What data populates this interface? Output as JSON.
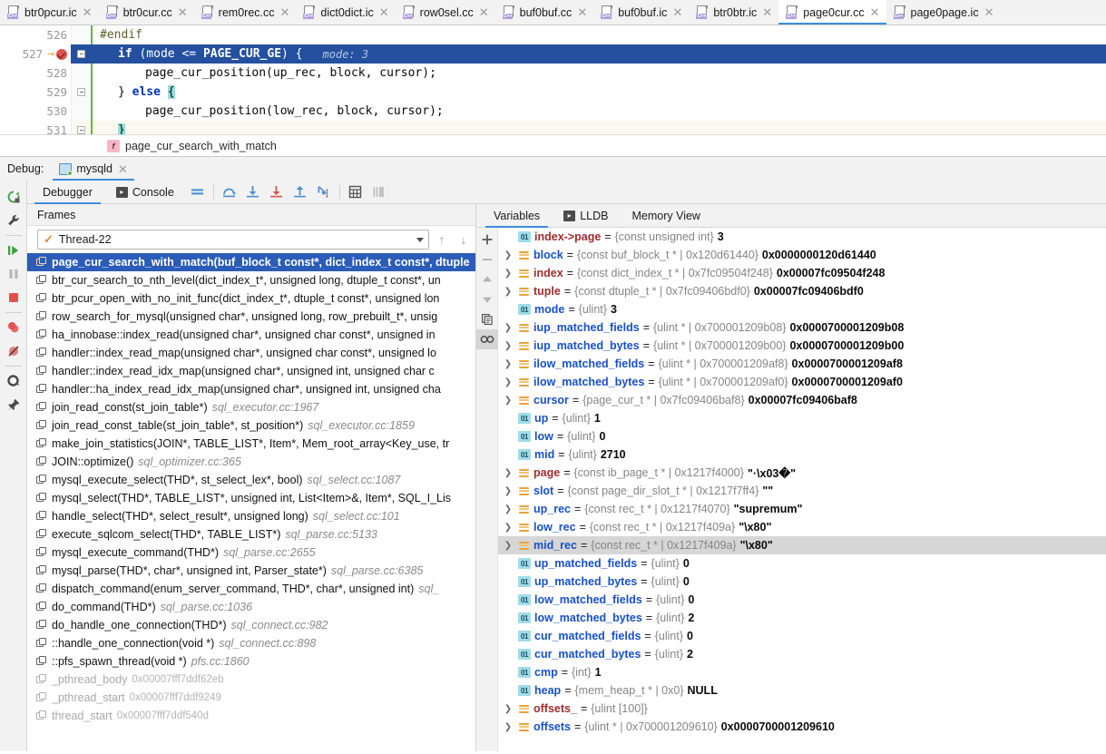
{
  "tabs": [
    {
      "label": "btr0pcur.ic",
      "active": false
    },
    {
      "label": "btr0cur.cc",
      "active": false
    },
    {
      "label": "rem0rec.cc",
      "active": false
    },
    {
      "label": "dict0dict.ic",
      "active": false
    },
    {
      "label": "row0sel.cc",
      "active": false
    },
    {
      "label": "buf0buf.cc",
      "active": false
    },
    {
      "label": "buf0buf.ic",
      "active": false
    },
    {
      "label": "btr0btr.ic",
      "active": false
    },
    {
      "label": "page0cur.cc",
      "active": true
    },
    {
      "label": "page0page.ic",
      "active": false
    }
  ],
  "tab_icon_label": "C++",
  "editor": {
    "lines": [
      {
        "number": "526",
        "highlighted": false,
        "text": "#endif"
      },
      {
        "number": "527",
        "highlighted": true,
        "text": "if (mode <= PAGE_CUR_GE) {",
        "hint": "mode: 3"
      },
      {
        "number": "528",
        "highlighted": false,
        "text": "page_cur_position(up_rec, block, cursor);"
      },
      {
        "number": "529",
        "highlighted": false,
        "text": "} else {"
      },
      {
        "number": "530",
        "highlighted": false,
        "text": "page_cur_position(low_rec, block, cursor);"
      },
      {
        "number": "531",
        "highlighted": false,
        "text": "}"
      }
    ]
  },
  "breadcrumb": {
    "function": "page_cur_search_with_match",
    "badge": "f"
  },
  "debug_header": {
    "label": "Debug:",
    "session": "mysqld"
  },
  "debug_tabs": {
    "debugger": "Debugger",
    "console": "Console"
  },
  "frames_panel": {
    "header": "Frames",
    "thread": "Thread-22",
    "items": [
      {
        "sig": "page_cur_search_with_match(buf_block_t const*, dict_index_t const*, dtuple",
        "loc": "",
        "selected": true,
        "dim": false
      },
      {
        "sig": "btr_cur_search_to_nth_level(dict_index_t*, unsigned long, dtuple_t const*, un",
        "loc": "",
        "selected": false,
        "dim": false
      },
      {
        "sig": "btr_pcur_open_with_no_init_func(dict_index_t*, dtuple_t const*, unsigned lon",
        "loc": "",
        "selected": false,
        "dim": false
      },
      {
        "sig": "row_search_for_mysql(unsigned char*, unsigned long, row_prebuilt_t*, unsig",
        "loc": "",
        "selected": false,
        "dim": false
      },
      {
        "sig": "ha_innobase::index_read(unsigned char*, unsigned char const*, unsigned in",
        "loc": "",
        "selected": false,
        "dim": false
      },
      {
        "sig": "handler::index_read_map(unsigned char*, unsigned char const*, unsigned lo",
        "loc": "",
        "selected": false,
        "dim": false
      },
      {
        "sig": "handler::index_read_idx_map(unsigned char*, unsigned int, unsigned char c",
        "loc": "",
        "selected": false,
        "dim": false
      },
      {
        "sig": "handler::ha_index_read_idx_map(unsigned char*, unsigned int, unsigned cha",
        "loc": "",
        "selected": false,
        "dim": false
      },
      {
        "sig": "join_read_const(st_join_table*)",
        "loc": "sql_executor.cc:1967",
        "selected": false,
        "dim": false
      },
      {
        "sig": "join_read_const_table(st_join_table*, st_position*)",
        "loc": "sql_executor.cc:1859",
        "selected": false,
        "dim": false
      },
      {
        "sig": "make_join_statistics(JOIN*, TABLE_LIST*, Item*, Mem_root_array<Key_use, tr",
        "loc": "",
        "selected": false,
        "dim": false
      },
      {
        "sig": "JOIN::optimize()",
        "loc": "sql_optimizer.cc:365",
        "selected": false,
        "dim": false
      },
      {
        "sig": "mysql_execute_select(THD*, st_select_lex*, bool)",
        "loc": "sql_select.cc:1087",
        "selected": false,
        "dim": false
      },
      {
        "sig": "mysql_select(THD*, TABLE_LIST*, unsigned int, List<Item>&, Item*, SQL_I_Lis",
        "loc": "",
        "selected": false,
        "dim": false
      },
      {
        "sig": "handle_select(THD*, select_result*, unsigned long)",
        "loc": "sql_select.cc:101",
        "selected": false,
        "dim": false
      },
      {
        "sig": "execute_sqlcom_select(THD*, TABLE_LIST*)",
        "loc": "sql_parse.cc:5133",
        "selected": false,
        "dim": false
      },
      {
        "sig": "mysql_execute_command(THD*)",
        "loc": "sql_parse.cc:2655",
        "selected": false,
        "dim": false
      },
      {
        "sig": "mysql_parse(THD*, char*, unsigned int, Parser_state*)",
        "loc": "sql_parse.cc:6385",
        "selected": false,
        "dim": false
      },
      {
        "sig": "dispatch_command(enum_server_command, THD*, char*, unsigned int)",
        "loc": "sql_",
        "selected": false,
        "dim": false
      },
      {
        "sig": "do_command(THD*)",
        "loc": "sql_parse.cc:1036",
        "selected": false,
        "dim": false
      },
      {
        "sig": "do_handle_one_connection(THD*)",
        "loc": "sql_connect.cc:982",
        "selected": false,
        "dim": false
      },
      {
        "sig": "::handle_one_connection(void *)",
        "loc": "sql_connect.cc:898",
        "selected": false,
        "dim": false
      },
      {
        "sig": "::pfs_spawn_thread(void *)",
        "loc": "pfs.cc:1860",
        "selected": false,
        "dim": false
      },
      {
        "sig": "_pthread_body",
        "addr": "0x00007fff7ddf62eb",
        "selected": false,
        "dim": true
      },
      {
        "sig": "_pthread_start",
        "addr": "0x00007fff7ddf9249",
        "selected": false,
        "dim": true
      },
      {
        "sig": "thread_start",
        "addr": "0x00007fff7ddf540d",
        "selected": false,
        "dim": true
      }
    ]
  },
  "variables_panel": {
    "tabs": [
      {
        "label": "Variables",
        "active": true
      },
      {
        "label": "LLDB",
        "active": false
      },
      {
        "label": "Memory View",
        "active": false
      }
    ],
    "items": [
      {
        "name": "index->page",
        "kind": "num",
        "color": "red",
        "expandable": false,
        "type": "{const unsigned int}",
        "value": "3",
        "selected": false
      },
      {
        "name": "block",
        "kind": "obj",
        "color": "blue",
        "expandable": true,
        "type": "{const buf_block_t * | 0x120d61440}",
        "value": "0x0000000120d61440",
        "selected": false
      },
      {
        "name": "index",
        "kind": "obj",
        "color": "red",
        "expandable": true,
        "type": "{const dict_index_t * | 0x7fc09504f248}",
        "value": "0x00007fc09504f248",
        "selected": false
      },
      {
        "name": "tuple",
        "kind": "obj",
        "color": "red",
        "expandable": true,
        "type": "{const dtuple_t * | 0x7fc09406bdf0}",
        "value": "0x00007fc09406bdf0",
        "selected": false
      },
      {
        "name": "mode",
        "kind": "num",
        "color": "blue",
        "expandable": false,
        "type": "{ulint}",
        "value": "3",
        "selected": false
      },
      {
        "name": "iup_matched_fields",
        "kind": "obj",
        "color": "blue",
        "expandable": true,
        "type": "{ulint * | 0x700001209b08}",
        "value": "0x0000700001209b08",
        "selected": false
      },
      {
        "name": "iup_matched_bytes",
        "kind": "obj",
        "color": "blue",
        "expandable": true,
        "type": "{ulint * | 0x700001209b00}",
        "value": "0x0000700001209b00",
        "selected": false
      },
      {
        "name": "ilow_matched_fields",
        "kind": "obj",
        "color": "blue",
        "expandable": true,
        "type": "{ulint * | 0x700001209af8}",
        "value": "0x0000700001209af8",
        "selected": false
      },
      {
        "name": "ilow_matched_bytes",
        "kind": "obj",
        "color": "blue",
        "expandable": true,
        "type": "{ulint * | 0x700001209af0}",
        "value": "0x0000700001209af0",
        "selected": false
      },
      {
        "name": "cursor",
        "kind": "obj",
        "color": "blue",
        "expandable": true,
        "type": "{page_cur_t * | 0x7fc09406baf8}",
        "value": "0x00007fc09406baf8",
        "selected": false
      },
      {
        "name": "up",
        "kind": "num",
        "color": "blue",
        "expandable": false,
        "type": "{ulint}",
        "value": "1",
        "selected": false
      },
      {
        "name": "low",
        "kind": "num",
        "color": "blue",
        "expandable": false,
        "type": "{ulint}",
        "value": "0",
        "selected": false
      },
      {
        "name": "mid",
        "kind": "num",
        "color": "blue",
        "expandable": false,
        "type": "{ulint}",
        "value": "2710",
        "selected": false
      },
      {
        "name": "page",
        "kind": "obj",
        "color": "red",
        "expandable": true,
        "type": "{const ib_page_t * | 0x1217f4000}",
        "value": "\"·\\x03�\"",
        "selected": false
      },
      {
        "name": "slot",
        "kind": "obj",
        "color": "blue",
        "expandable": true,
        "type": "{const page_dir_slot_t * | 0x1217f7ff4}",
        "value": "\"\"",
        "selected": false
      },
      {
        "name": "up_rec",
        "kind": "obj",
        "color": "blue",
        "expandable": true,
        "type": "{const rec_t * | 0x1217f4070}",
        "value": "\"supremum\"",
        "selected": false
      },
      {
        "name": "low_rec",
        "kind": "obj",
        "color": "blue",
        "expandable": true,
        "type": "{const rec_t * | 0x1217f409a}",
        "value": "\"\\x80\"",
        "selected": false
      },
      {
        "name": "mid_rec",
        "kind": "obj",
        "color": "blue",
        "expandable": true,
        "type": "{const rec_t * | 0x1217f409a}",
        "value": "\"\\x80\"",
        "selected": true
      },
      {
        "name": "up_matched_fields",
        "kind": "num",
        "color": "blue",
        "expandable": false,
        "type": "{ulint}",
        "value": "0",
        "selected": false
      },
      {
        "name": "up_matched_bytes",
        "kind": "num",
        "color": "blue",
        "expandable": false,
        "type": "{ulint}",
        "value": "0",
        "selected": false
      },
      {
        "name": "low_matched_fields",
        "kind": "num",
        "color": "blue",
        "expandable": false,
        "type": "{ulint}",
        "value": "0",
        "selected": false
      },
      {
        "name": "low_matched_bytes",
        "kind": "num",
        "color": "blue",
        "expandable": false,
        "type": "{ulint}",
        "value": "2",
        "selected": false
      },
      {
        "name": "cur_matched_fields",
        "kind": "num",
        "color": "blue",
        "expandable": false,
        "type": "{ulint}",
        "value": "0",
        "selected": false
      },
      {
        "name": "cur_matched_bytes",
        "kind": "num",
        "color": "blue",
        "expandable": false,
        "type": "{ulint}",
        "value": "2",
        "selected": false
      },
      {
        "name": "cmp",
        "kind": "num",
        "color": "blue",
        "expandable": false,
        "type": "{int}",
        "value": "1",
        "selected": false
      },
      {
        "name": "heap",
        "kind": "num",
        "color": "blue",
        "expandable": false,
        "type": "{mem_heap_t * | 0x0}",
        "value": "NULL",
        "selected": false
      },
      {
        "name": "offsets_",
        "kind": "obj",
        "color": "red",
        "expandable": true,
        "type": "{ulint [100]}",
        "value": "",
        "selected": false
      },
      {
        "name": "offsets",
        "kind": "obj",
        "color": "blue",
        "expandable": true,
        "type": "{ulint * | 0x700001209610}",
        "value": "0x0000700001209610",
        "selected": false
      }
    ]
  },
  "colors": {
    "accent_blue": "#3f8cd9",
    "selection_blue": "#2a5cb8",
    "code_highlight": "#24509f",
    "breakpoint_red": "#e05252",
    "resume_green": "#62b543",
    "pointer_orange": "#e8a33d",
    "primitive_cyan": "#9fdcea"
  }
}
